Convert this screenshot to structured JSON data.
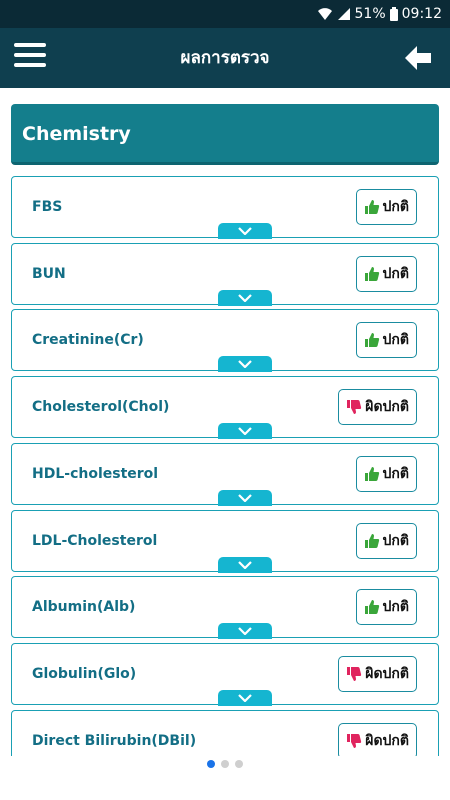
{
  "statusbar": {
    "battery": "51%",
    "time": "09:12"
  },
  "appbar": {
    "title": "ผลการตรวจ"
  },
  "section": {
    "title": "Chemistry"
  },
  "tests": [
    {
      "name": "FBS",
      "status": "ปกติ",
      "normal": true
    },
    {
      "name": "BUN",
      "status": "ปกติ",
      "normal": true
    },
    {
      "name": "Creatinine(Cr)",
      "status": "ปกติ",
      "normal": true
    },
    {
      "name": "Cholesterol(Chol)",
      "status": "ผิดปกติ",
      "normal": false
    },
    {
      "name": "HDL-cholesterol",
      "status": "ปกติ",
      "normal": true
    },
    {
      "name": "LDL-Cholesterol",
      "status": "ปกติ",
      "normal": true
    },
    {
      "name": "Albumin(Alb)",
      "status": "ปกติ",
      "normal": true
    },
    {
      "name": "Globulin(Glo)",
      "status": "ผิดปกติ",
      "normal": false
    },
    {
      "name": "Direct Bilirubin(DBil)",
      "status": "ผิดปกติ",
      "normal": false
    }
  ],
  "colors": {
    "header": "#0f3f4f",
    "section": "#147e8c",
    "normal_icon": "#3aa63a",
    "abnormal_icon": "#e0245e",
    "active_dot": "#1a73e8"
  },
  "pager": {
    "active_index": 0,
    "count": 3
  }
}
